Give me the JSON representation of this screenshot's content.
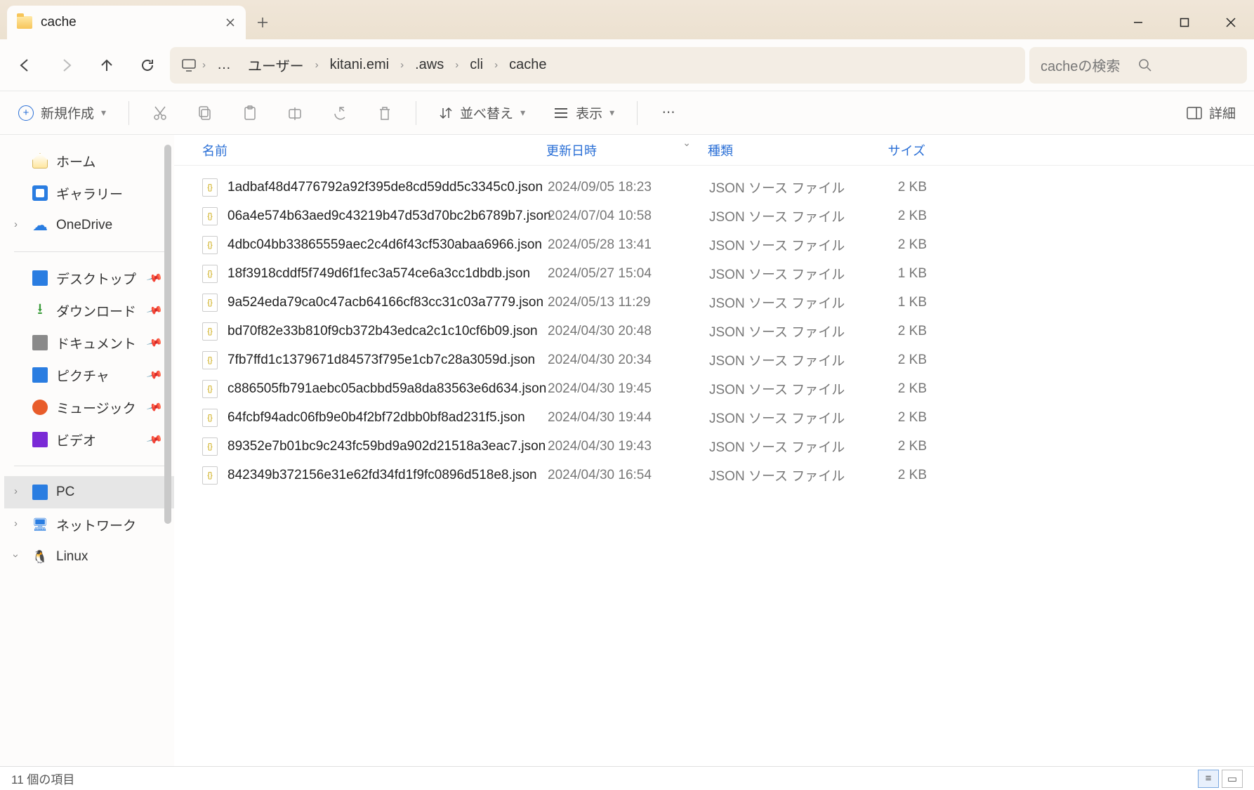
{
  "tab": {
    "title": "cache"
  },
  "breadcrumb": {
    "items": [
      "ユーザー",
      "kitani.emi",
      ".aws",
      "cli",
      "cache"
    ],
    "ellipsis": "…"
  },
  "search": {
    "placeholder": "cacheの検索"
  },
  "toolbar": {
    "new_label": "新規作成",
    "sort_label": "並べ替え",
    "view_label": "表示",
    "details_label": "詳細"
  },
  "columns": {
    "name": "名前",
    "date": "更新日時",
    "type": "種類",
    "size": "サイズ"
  },
  "sidebar": {
    "home": "ホーム",
    "gallery": "ギャラリー",
    "onedrive": "OneDrive",
    "desktop": "デスクトップ",
    "downloads": "ダウンロード",
    "documents": "ドキュメント",
    "pictures": "ピクチャ",
    "music": "ミュージック",
    "videos": "ビデオ",
    "pc": "PC",
    "network": "ネットワーク",
    "linux": "Linux"
  },
  "files": [
    {
      "name": "1adbaf48d4776792a92f395de8cd59dd5c3345c0.json",
      "date": "2024/09/05 18:23",
      "type": "JSON ソース ファイル",
      "size": "2 KB"
    },
    {
      "name": "06a4e574b63aed9c43219b47d53d70bc2b6789b7.json",
      "date": "2024/07/04 10:58",
      "type": "JSON ソース ファイル",
      "size": "2 KB"
    },
    {
      "name": "4dbc04bb33865559aec2c4d6f43cf530abaa6966.json",
      "date": "2024/05/28 13:41",
      "type": "JSON ソース ファイル",
      "size": "2 KB"
    },
    {
      "name": "18f3918cddf5f749d6f1fec3a574ce6a3cc1dbdb.json",
      "date": "2024/05/27 15:04",
      "type": "JSON ソース ファイル",
      "size": "1 KB"
    },
    {
      "name": "9a524eda79ca0c47acb64166cf83cc31c03a7779.json",
      "date": "2024/05/13 11:29",
      "type": "JSON ソース ファイル",
      "size": "1 KB"
    },
    {
      "name": "bd70f82e33b810f9cb372b43edca2c1c10cf6b09.json",
      "date": "2024/04/30 20:48",
      "type": "JSON ソース ファイル",
      "size": "2 KB"
    },
    {
      "name": "7fb7ffd1c1379671d84573f795e1cb7c28a3059d.json",
      "date": "2024/04/30 20:34",
      "type": "JSON ソース ファイル",
      "size": "2 KB"
    },
    {
      "name": "c886505fb791aebc05acbbd59a8da83563e6d634.json",
      "date": "2024/04/30 19:45",
      "type": "JSON ソース ファイル",
      "size": "2 KB"
    },
    {
      "name": "64fcbf94adc06fb9e0b4f2bf72dbb0bf8ad231f5.json",
      "date": "2024/04/30 19:44",
      "type": "JSON ソース ファイル",
      "size": "2 KB"
    },
    {
      "name": "89352e7b01bc9c243fc59bd9a902d21518a3eac7.json",
      "date": "2024/04/30 19:43",
      "type": "JSON ソース ファイル",
      "size": "2 KB"
    },
    {
      "name": "842349b372156e31e62fd34fd1f9fc0896d518e8.json",
      "date": "2024/04/30 16:54",
      "type": "JSON ソース ファイル",
      "size": "2 KB"
    }
  ],
  "status": {
    "count_label": "11 個の項目"
  }
}
